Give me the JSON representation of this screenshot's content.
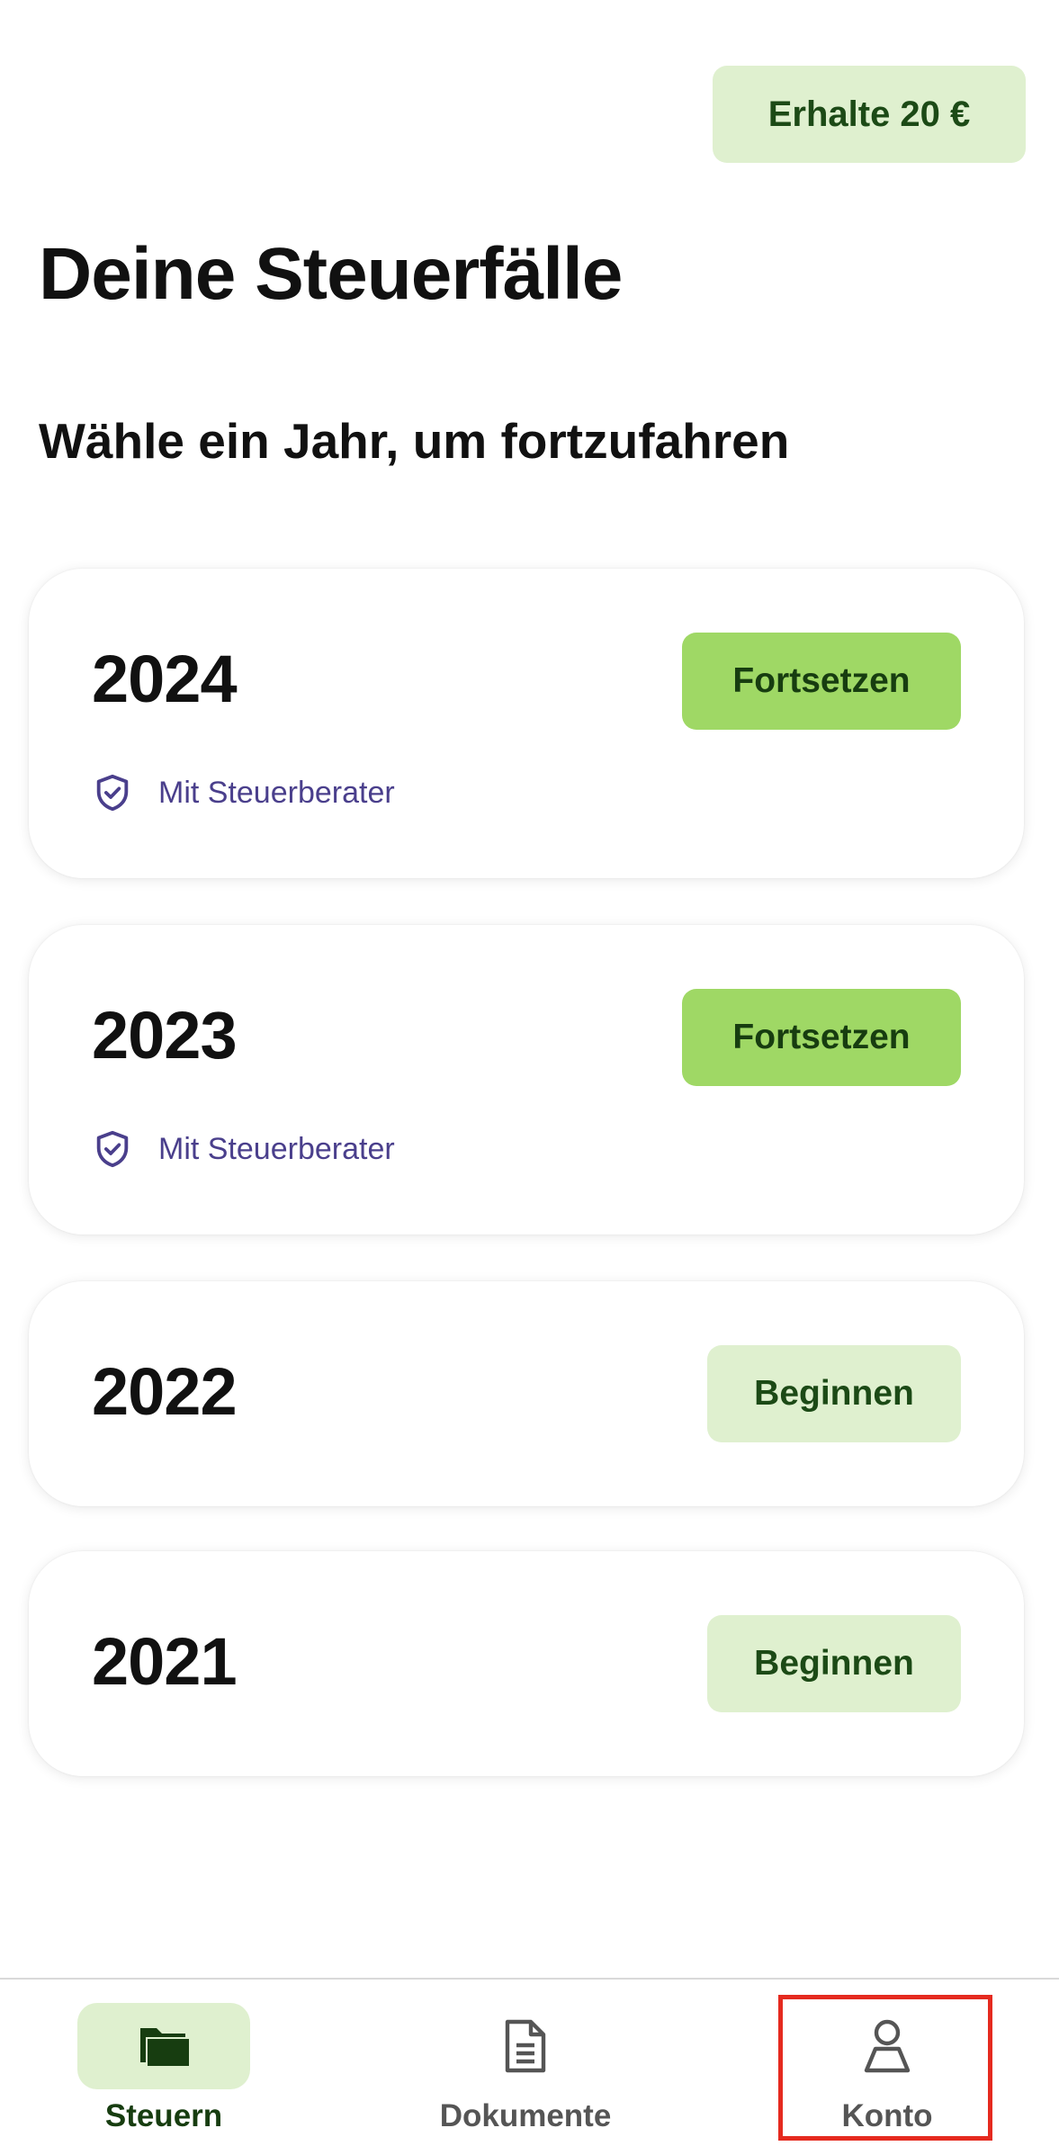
{
  "header": {
    "referral_label": "Erhalte 20 €"
  },
  "main": {
    "title": "Deine Steuerfälle",
    "subtitle": "Wähle ein Jahr, um fortzufahren",
    "cards": [
      {
        "year": "2024",
        "button_label": "Fortsetzen",
        "badge_label": "Mit Steuerberater"
      },
      {
        "year": "2023",
        "button_label": "Fortsetzen",
        "badge_label": "Mit Steuerberater"
      },
      {
        "year": "2022",
        "button_label": "Beginnen"
      },
      {
        "year": "2021",
        "button_label": "Beginnen"
      }
    ]
  },
  "bottom_nav": {
    "items": [
      {
        "label": "Steuern",
        "icon": "folder-icon",
        "active": true
      },
      {
        "label": "Dokumente",
        "icon": "document-icon",
        "active": false
      },
      {
        "label": "Konto",
        "icon": "person-icon",
        "active": false
      }
    ]
  },
  "colors": {
    "accent_green": "#9fd865",
    "light_green": "#dff0cf",
    "dark_green": "#173d10",
    "advisor_purple": "#4a3f8c",
    "highlight_red": "#e52a1f"
  }
}
